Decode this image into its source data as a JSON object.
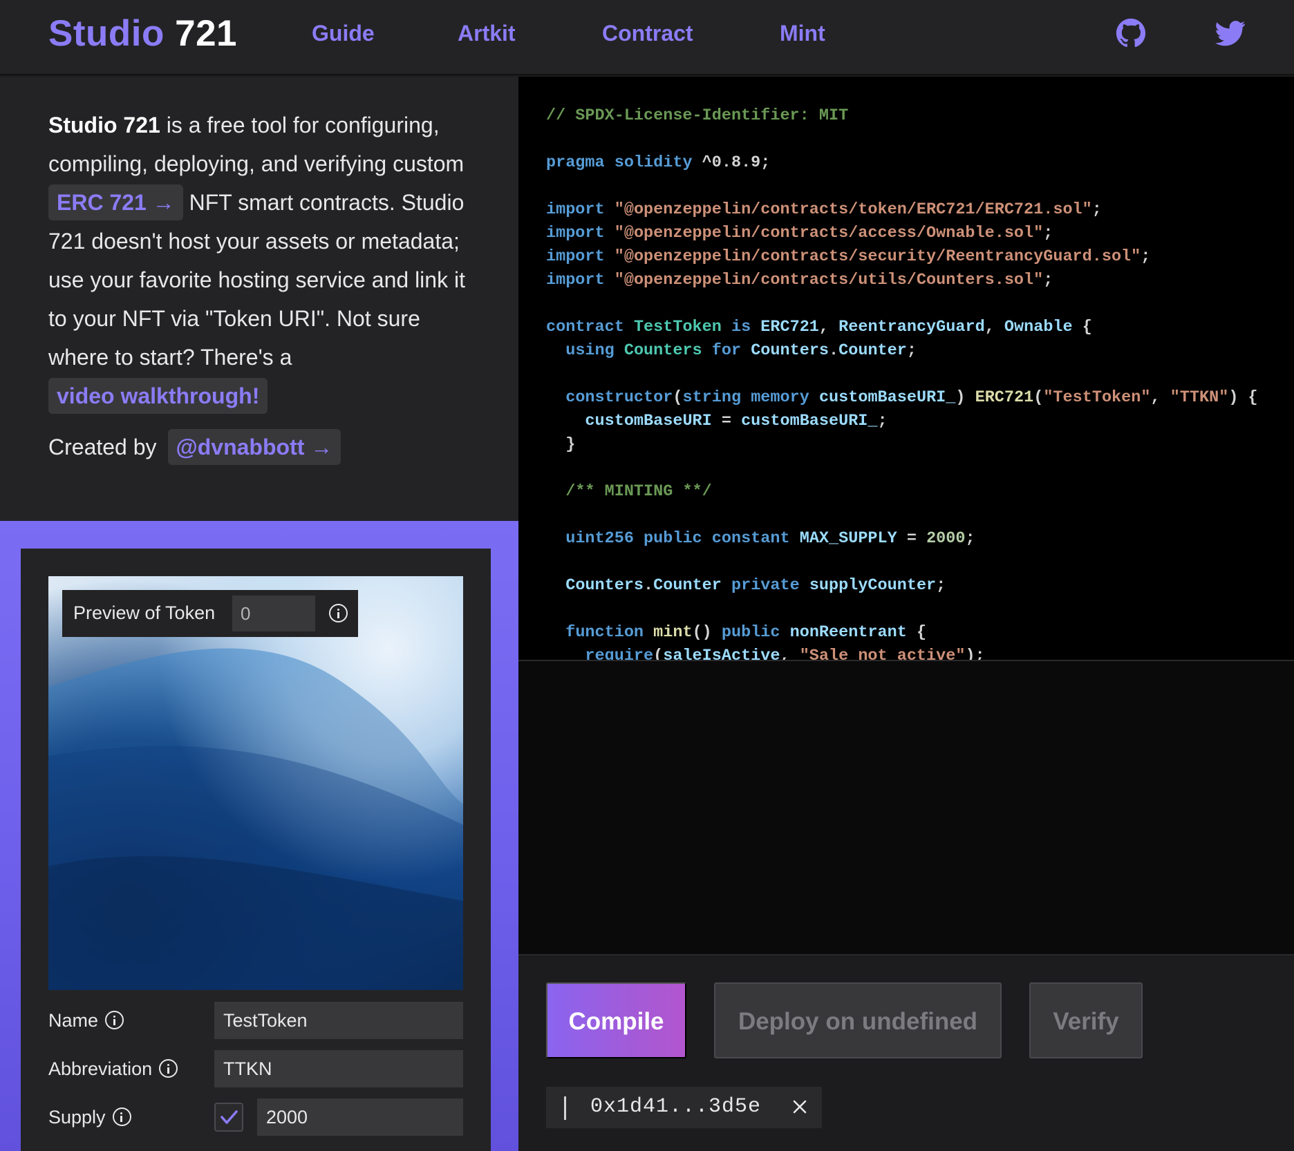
{
  "brand": {
    "part1": "Studio",
    "part2": "721"
  },
  "nav": {
    "links": [
      "Guide",
      "Artkit",
      "Contract",
      "Mint"
    ],
    "icons": [
      "github-icon",
      "twitter-icon"
    ]
  },
  "intro": {
    "bold": "Studio 721",
    "text1": " is a free tool for configuring, compiling, deploying, and verifying custom ",
    "erc_link": "ERC 721 →",
    "text2": " NFT smart contracts. Studio 721 doesn't host your assets or metadata; use your favorite hosting service and link it to your NFT via \"Token URI\". Not sure where to start? There's a ",
    "video_link": "video walkthrough!",
    "credit_prefix": "Created by",
    "credit_link": "@dvnabbott →"
  },
  "preview": {
    "label": "Preview of Token",
    "token_index": "0"
  },
  "form": {
    "name_label": "Name",
    "name_value": "TestToken",
    "abbr_label": "Abbreviation",
    "abbr_value": "TTKN",
    "supply_label": "Supply",
    "supply_checked": true,
    "supply_value": "2000"
  },
  "code": {
    "license": "// SPDX-License-Identifier: MIT",
    "pragma_kw": "pragma",
    "pragma_name": "solidity",
    "pragma_ver": "^0.8.9;",
    "import_kw": "import",
    "imports": [
      "\"@openzeppelin/contracts/token/ERC721/ERC721.sol\"",
      "\"@openzeppelin/contracts/access/Ownable.sol\"",
      "\"@openzeppelin/contracts/security/ReentrancyGuard.sol\"",
      "\"@openzeppelin/contracts/utils/Counters.sol\""
    ],
    "contract_name": "TestToken",
    "token_name_str": "\"TestToken\"",
    "token_sym_str": "\"TTKN\"",
    "minting_comment": "/** MINTING **/",
    "max_supply": "2000",
    "sale_msg": "\"Sale not active\""
  },
  "actions": {
    "compile": "Compile",
    "deploy": "Deploy on undefined",
    "verify": "Verify"
  },
  "wallet": {
    "address": "0x1d41...3d5e"
  },
  "colors": {
    "accent": "#8b7cf6",
    "panel_gradient_top": "#7b6df3",
    "compile_gradient": [
      "#8a64f0",
      "#b356cf"
    ]
  }
}
